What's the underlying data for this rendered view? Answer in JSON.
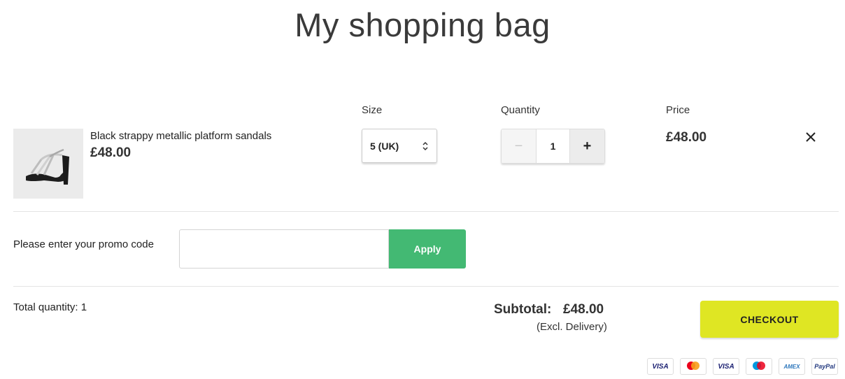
{
  "page": {
    "title": "My shopping bag"
  },
  "columns": {
    "size": "Size",
    "quantity": "Quantity",
    "price": "Price"
  },
  "item": {
    "name": "Black strappy metallic platform sandals",
    "unit_price": "£48.00",
    "size": "5 (UK)",
    "quantity": "1",
    "line_price": "£48.00",
    "image_icon": "sandal-product-image"
  },
  "quantity_controls": {
    "minus": "−",
    "plus": "+"
  },
  "promo": {
    "label": "Please enter your promo code",
    "value": "",
    "placeholder": "",
    "apply_label": "Apply"
  },
  "summary": {
    "total_quantity": "Total quantity: 1",
    "subtotal_label": "Subtotal:",
    "subtotal_value": "£48.00",
    "delivery_note": "(Excl. Delivery)",
    "checkout_label": "CHECKOUT"
  },
  "payment_methods": [
    {
      "label": "VISA",
      "icon": "visa-icon"
    },
    {
      "label": "",
      "icon": "mastercard-icon"
    },
    {
      "label": "VISA",
      "icon": "visa-debit-icon"
    },
    {
      "label": "",
      "icon": "maestro-icon"
    },
    {
      "label": "AMEX",
      "icon": "amex-icon"
    },
    {
      "label": "PayPal",
      "icon": "paypal-icon"
    }
  ],
  "colors": {
    "apply_button": "#43b973",
    "checkout_button": "#dfe623",
    "text": "#222222"
  }
}
